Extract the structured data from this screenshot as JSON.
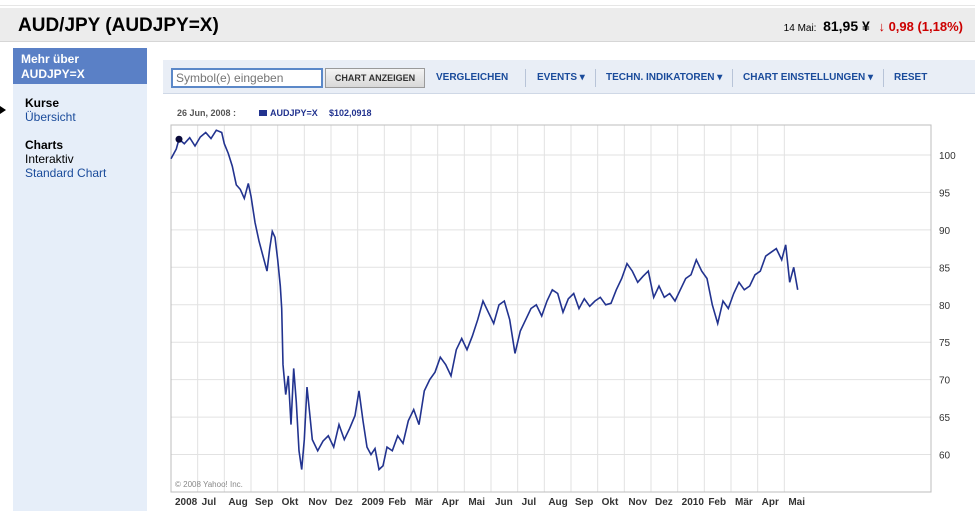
{
  "header": {
    "title": "AUD/JPY (AUDJPY=X)",
    "quote_date": "14 Mai:",
    "price": "81,95 ¥",
    "arrow_icon": "down-arrow-icon",
    "change": "0,98 (1,18%)"
  },
  "sidebar": {
    "heading": "Mehr über AUDJPY=X",
    "groups": [
      {
        "label": "Kurse",
        "items": [
          "Übersicht"
        ]
      },
      {
        "label": "Charts",
        "items": [
          "Interaktiv",
          "Standard Chart"
        ]
      }
    ]
  },
  "toolbar": {
    "symbol_placeholder": "Symbol(e) eingeben",
    "symbol_value": "Symbol(e) eingeben",
    "show_chart": "CHART ANZEIGEN",
    "compare": "VERGLEICHEN",
    "events": "EVENTS ▾",
    "indicators": "TECHN. INDIKATOREN ▾",
    "settings": "CHART EINSTELLUNGEN ▾",
    "reset": "RESET"
  },
  "chart_data": {
    "type": "line",
    "title": "",
    "hover_date": "26 Jun, 2008 :",
    "legend_entry": "AUDJPY=X",
    "hover_value": "$102,0918",
    "copyright": "© 2008 Yahoo! Inc.",
    "colors": {
      "line": "#22338f",
      "marker": "#0a0a3a",
      "grid": "#e2e2e2"
    },
    "ylim": [
      55,
      104
    ],
    "y_ticks": [
      60,
      65,
      70,
      75,
      80,
      85,
      90,
      95,
      100
    ],
    "x_range": [
      0,
      28.5
    ],
    "x_ticks": [
      {
        "label": "2008",
        "m": 0,
        "bold": true
      },
      {
        "label": "Jul",
        "m": 1
      },
      {
        "label": "Aug",
        "m": 2
      },
      {
        "label": "Sep",
        "m": 3
      },
      {
        "label": "Okt",
        "m": 4
      },
      {
        "label": "Nov",
        "m": 5
      },
      {
        "label": "Dez",
        "m": 6
      },
      {
        "label": "2009",
        "m": 7,
        "bold": true
      },
      {
        "label": "Feb",
        "m": 8
      },
      {
        "label": "Mär",
        "m": 9
      },
      {
        "label": "Apr",
        "m": 10
      },
      {
        "label": "Mai",
        "m": 11
      },
      {
        "label": "Jun",
        "m": 12
      },
      {
        "label": "Jul",
        "m": 13
      },
      {
        "label": "Aug",
        "m": 14
      },
      {
        "label": "Sep",
        "m": 15
      },
      {
        "label": "Okt",
        "m": 16
      },
      {
        "label": "Nov",
        "m": 17
      },
      {
        "label": "Dez",
        "m": 18
      },
      {
        "label": "2010",
        "m": 19,
        "bold": true
      },
      {
        "label": "Feb",
        "m": 20
      },
      {
        "label": "Mär",
        "m": 21
      },
      {
        "label": "Apr",
        "m": 22
      },
      {
        "label": "Mai",
        "m": 23
      }
    ],
    "marker_point": {
      "x": 0.3,
      "y": 102.1
    },
    "series": [
      {
        "x": [
          0,
          0.2,
          0.3,
          0.5,
          0.7,
          0.9,
          1.1,
          1.3,
          1.5,
          1.7,
          1.9,
          2.0,
          2.15,
          2.3,
          2.45,
          2.6,
          2.75,
          2.9,
          3.0,
          3.15,
          3.3,
          3.45,
          3.6,
          3.7,
          3.8,
          3.9,
          4.0,
          4.1,
          4.15,
          4.2,
          4.3,
          4.4,
          4.5,
          4.6,
          4.7,
          4.8,
          4.9,
          5.0,
          5.1,
          5.2,
          5.3,
          5.5,
          5.7,
          5.9,
          6.1,
          6.3,
          6.5,
          6.7,
          6.9,
          7.05,
          7.2,
          7.35,
          7.5,
          7.65,
          7.8,
          7.95,
          8.1,
          8.3,
          8.5,
          8.7,
          8.9,
          9.1,
          9.3,
          9.5,
          9.7,
          9.9,
          10.1,
          10.3,
          10.5,
          10.7,
          10.9,
          11.1,
          11.3,
          11.5,
          11.7,
          11.9,
          12.1,
          12.3,
          12.5,
          12.7,
          12.9,
          13.1,
          13.3,
          13.5,
          13.7,
          13.9,
          14.1,
          14.3,
          14.5,
          14.7,
          14.9,
          15.1,
          15.3,
          15.5,
          15.7,
          15.9,
          16.1,
          16.3,
          16.5,
          16.7,
          16.9,
          17.1,
          17.3,
          17.5,
          17.7,
          17.9,
          18.1,
          18.3,
          18.5,
          18.7,
          18.9,
          19.1,
          19.3,
          19.5,
          19.7,
          19.9,
          20.1,
          20.3,
          20.5,
          20.7,
          20.9,
          21.1,
          21.3,
          21.5,
          21.7,
          21.9,
          22.1,
          22.3,
          22.5,
          22.7,
          22.9,
          23.05,
          23.2,
          23.35,
          23.5
        ],
        "y": [
          99.5,
          100.8,
          102.1,
          101.5,
          102.3,
          101.2,
          102.4,
          103.0,
          102.2,
          103.3,
          103.0,
          101.5,
          100.2,
          98.5,
          96.0,
          95.4,
          94.2,
          96.2,
          94.5,
          91.0,
          88.5,
          86.5,
          84.5,
          87.5,
          89.8,
          89.0,
          86.0,
          82.5,
          79.5,
          72.0,
          68.0,
          70.5,
          64.0,
          71.5,
          67.0,
          60.5,
          58.0,
          62.0,
          69.0,
          65.5,
          62.0,
          60.5,
          61.8,
          62.5,
          61.0,
          64.0,
          62.0,
          63.5,
          65.2,
          68.5,
          64.5,
          61.0,
          60.0,
          60.8,
          58.0,
          58.5,
          61.0,
          60.5,
          62.5,
          61.5,
          64.5,
          66.0,
          64.0,
          68.5,
          70.0,
          71.0,
          73.0,
          72.0,
          70.5,
          74.0,
          75.5,
          74.0,
          75.8,
          78.0,
          80.5,
          79.0,
          77.5,
          80.0,
          80.5,
          78.0,
          73.5,
          76.5,
          78.0,
          79.5,
          80.0,
          78.5,
          80.5,
          82.0,
          81.5,
          79.0,
          80.8,
          81.5,
          79.5,
          80.8,
          79.8,
          80.5,
          81.0,
          80.0,
          80.2,
          82.0,
          83.5,
          85.5,
          84.5,
          83.0,
          83.8,
          84.5,
          81.0,
          82.5,
          81.0,
          81.5,
          80.5,
          82.0,
          83.5,
          84.0,
          86.0,
          84.5,
          83.5,
          80.0,
          77.5,
          80.5,
          79.5,
          81.5,
          83.0,
          82.0,
          82.5,
          84.0,
          84.5,
          86.5,
          87.0,
          87.5,
          86.0,
          88.0,
          83.0,
          85.0,
          82.0
        ]
      }
    ]
  }
}
